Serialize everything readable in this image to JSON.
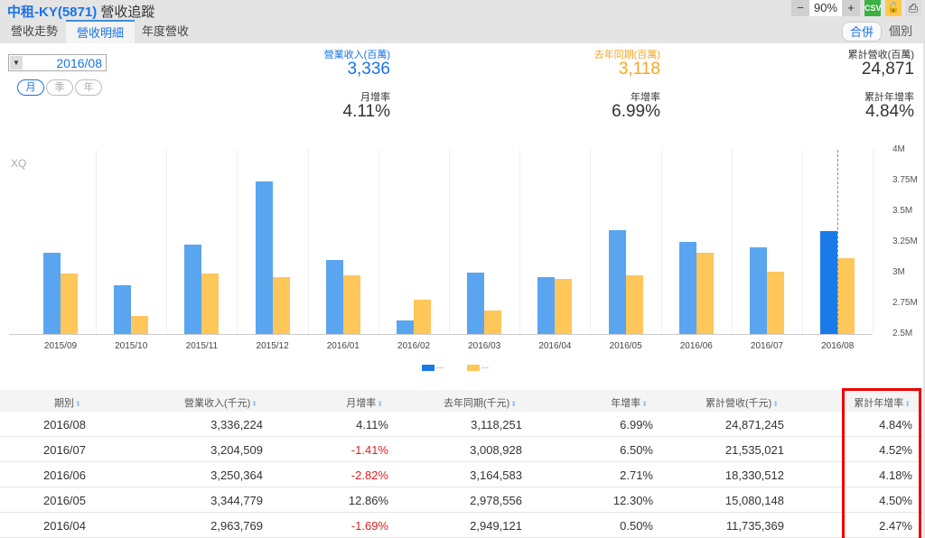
{
  "header": {
    "symbol": "中租-KY(5871)",
    "title": "營收追蹤",
    "zoom": "90%",
    "csv": "CSV"
  },
  "tabs": [
    {
      "label": "營收走勢"
    },
    {
      "label": "營收明細"
    },
    {
      "label": "年度營收"
    }
  ],
  "scope": {
    "consolidated": "合併",
    "individual": "個別"
  },
  "period": {
    "value": "2016/08",
    "buttons": [
      "月",
      "季",
      "年"
    ]
  },
  "summary": {
    "revenue_label": "營業收入(百萬)",
    "revenue": "3,336",
    "mom_label": "月增率",
    "mom": "4.11%",
    "prev_label": "去年同期(百萬)",
    "prev": "3,118",
    "yoy_label": "年增率",
    "yoy": "6.99%",
    "cum_label": "累計營收(百萬)",
    "cum": "24,871",
    "cum_yoy_label": "累計年增率",
    "cum_yoy": "4.84%"
  },
  "colors": {
    "blue": "#5aa5f0",
    "blue_selected": "#1a7ae8",
    "orange": "#ffc65a"
  },
  "chart_data": {
    "type": "bar",
    "watermark": "XQ",
    "categories": [
      "2015/09",
      "2015/10",
      "2015/11",
      "2015/12",
      "2016/01",
      "2016/02",
      "2016/03",
      "2016/04",
      "2016/05",
      "2016/06",
      "2016/07",
      "2016/08"
    ],
    "series": [
      {
        "name": "...",
        "values": [
          3.16,
          2.9,
          3.23,
          3.74,
          3.1,
          2.61,
          3.0,
          2.964,
          3.345,
          3.25,
          3.205,
          3.336
        ]
      },
      {
        "name": "...",
        "values": [
          2.99,
          2.65,
          2.99,
          2.96,
          2.98,
          2.78,
          2.69,
          2.949,
          2.979,
          3.165,
          3.009,
          3.118
        ]
      }
    ],
    "ylim": [
      2.5,
      4
    ],
    "yticks": [
      "2.5M",
      "2.75M",
      "3M",
      "3.25M",
      "3.5M",
      "3.75M",
      "4M"
    ]
  },
  "table": {
    "columns": [
      "期別",
      "營業收入(千元)",
      "月增率",
      "去年同期(千元)",
      "年增率",
      "累計營收(千元)",
      "累計年增率"
    ],
    "rows": [
      [
        "2016/08",
        "3,336,224",
        "4.11%",
        "3,118,251",
        "6.99%",
        "24,871,245",
        "4.84%"
      ],
      [
        "2016/07",
        "3,204,509",
        "-1.41%",
        "3,008,928",
        "6.50%",
        "21,535,021",
        "4.52%"
      ],
      [
        "2016/06",
        "3,250,364",
        "-2.82%",
        "3,164,583",
        "2.71%",
        "18,330,512",
        "4.18%"
      ],
      [
        "2016/05",
        "3,344,779",
        "12.86%",
        "2,978,556",
        "12.30%",
        "15,080,148",
        "4.50%"
      ],
      [
        "2016/04",
        "2,963,769",
        "-1.69%",
        "2,949,121",
        "0.50%",
        "11,735,369",
        "2.47%"
      ]
    ]
  }
}
